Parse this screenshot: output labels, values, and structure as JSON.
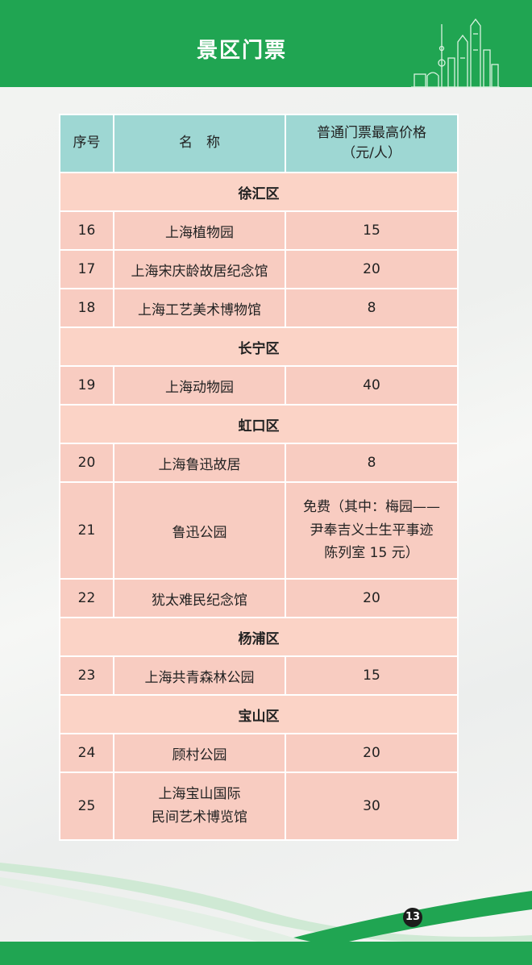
{
  "header": {
    "title": "景区门票"
  },
  "table": {
    "columns": [
      "序号",
      "名　称",
      "普通门票最高价格",
      "（元/人）"
    ],
    "sections": [
      {
        "district": "徐汇区",
        "rows": [
          {
            "no": "16",
            "name": "上海植物园",
            "price": "15"
          },
          {
            "no": "17",
            "name": "上海宋庆龄故居纪念馆",
            "price": "20"
          },
          {
            "no": "18",
            "name": "上海工艺美术博物馆",
            "price": "8"
          }
        ]
      },
      {
        "district": "长宁区",
        "rows": [
          {
            "no": "19",
            "name": "上海动物园",
            "price": "40"
          }
        ]
      },
      {
        "district": "虹口区",
        "rows": [
          {
            "no": "20",
            "name": "上海鲁迅故居",
            "price": "8"
          },
          {
            "no": "21",
            "name": "鲁迅公园",
            "price_lines": [
              "免费（其中：梅园——",
              "尹奉吉义士生平事迹",
              "陈列室 15 元）"
            ]
          },
          {
            "no": "22",
            "name": "犹太难民纪念馆",
            "price": "20"
          }
        ]
      },
      {
        "district": "杨浦区",
        "rows": [
          {
            "no": "23",
            "name": "上海共青森林公园",
            "price": "15"
          }
        ]
      },
      {
        "district": "宝山区",
        "rows": [
          {
            "no": "24",
            "name": "顾村公园",
            "price": "20"
          },
          {
            "no": "25",
            "name_lines": [
              "上海宝山国际",
              "民间艺术博览馆"
            ],
            "price": "30"
          }
        ]
      }
    ]
  },
  "page_number": "13",
  "colors": {
    "brand_green": "#20a552",
    "header_cell": "#9ed7d3",
    "row_cell": "#f8ccc1"
  },
  "icons": [
    "city-skyline-icon"
  ]
}
